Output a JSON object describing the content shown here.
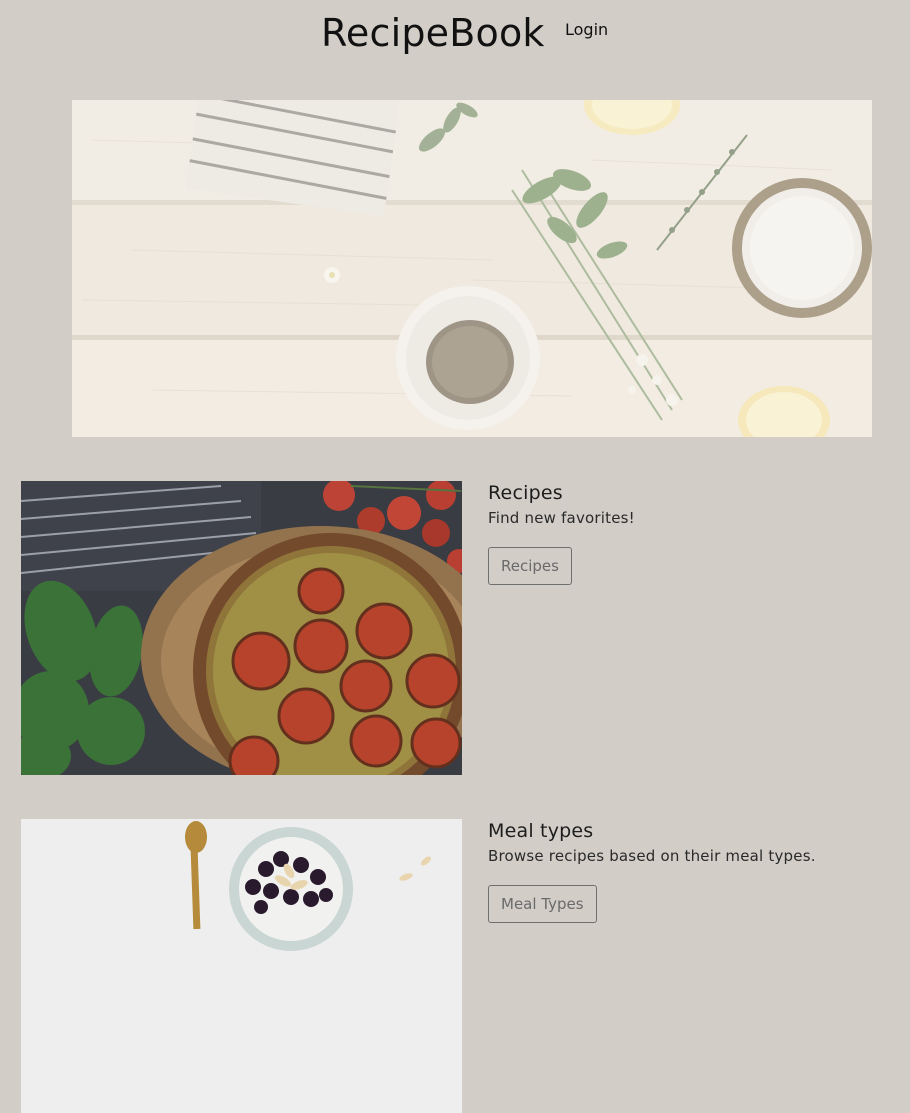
{
  "header": {
    "brand": "RecipeBook",
    "login_label": "Login"
  },
  "hero": {
    "image": "kitchen-ingredients-photo"
  },
  "sections": [
    {
      "title": "Recipes",
      "description": "Find new favorites!",
      "button_label": "Recipes",
      "image": "tomato-quiche-photo"
    },
    {
      "title": "Meal types",
      "description": "Browse recipes based on their meal types.",
      "button_label": "Meal Types",
      "image": "berry-bowl-photo"
    }
  ],
  "colors": {
    "background": "#d2cdc7",
    "text": "#222222",
    "button_border": "#6f6f6f"
  }
}
